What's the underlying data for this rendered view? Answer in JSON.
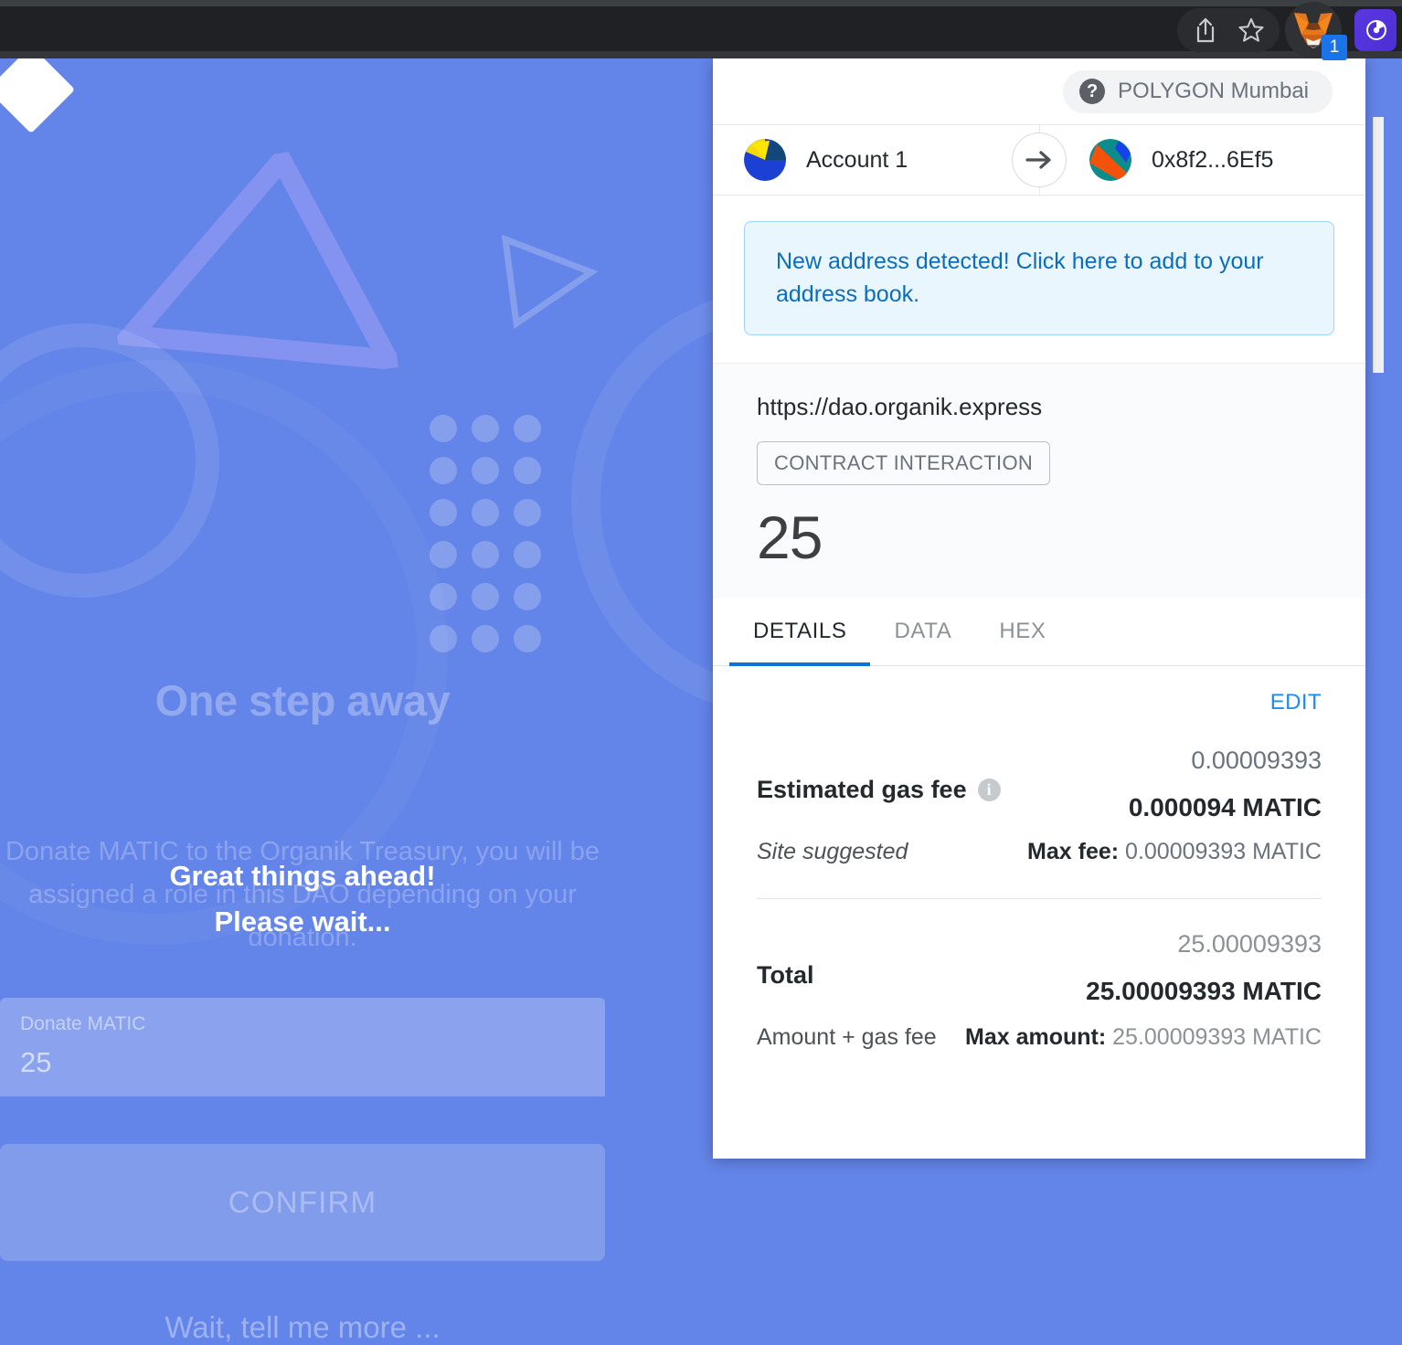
{
  "browser": {
    "icons": [
      {
        "name": "share-icon",
        "label": "Share"
      },
      {
        "name": "bookmark-star-icon",
        "label": "Bookmark"
      },
      {
        "name": "metamask-extension-icon",
        "label": "MetaMask"
      },
      {
        "name": "extension-purple-icon",
        "label": "Extension"
      }
    ],
    "metamask_badge": "1"
  },
  "dapp": {
    "hero_title": "One step away",
    "hero_subtitle": "Donate MATIC to the Organik Treasury, you will be assigned a role in this DAO depending on your donation.",
    "waiting_line1": "Great things ahead!",
    "waiting_line2": "Please wait...",
    "donate_label": "Donate MATIC",
    "donate_value": "25",
    "confirm_label": "CONFIRM",
    "more_link": "Wait, tell me more ..."
  },
  "popup": {
    "network": {
      "icon": "question-mark-icon",
      "name": "POLYGON Mumbai"
    },
    "accounts": {
      "from": "Account 1",
      "to": "0x8f2...6Ef5",
      "arrow": "arrow-right-icon"
    },
    "alert": "New address detected! Click here to add to your address book.",
    "origin": {
      "url": "https://dao.organik.express",
      "tag": "CONTRACT INTERACTION",
      "amount": "25"
    },
    "tabs": [
      {
        "label": "DETAILS",
        "active": true
      },
      {
        "label": "DATA",
        "active": false
      },
      {
        "label": "HEX",
        "active": false
      }
    ],
    "details": {
      "edit_label": "EDIT",
      "gas": {
        "title": "Estimated gas fee",
        "fiat": "0.00009393",
        "main": "0.000094 MATIC",
        "suggested": "Site suggested",
        "max_label": "Max fee:",
        "max_value": "0.00009393 MATIC"
      },
      "total": {
        "title": "Total",
        "fiat": "25.00009393",
        "main": "25.00009393 MATIC",
        "note": "Amount + gas fee",
        "max_label": "Max amount:",
        "max_value": "25.00009393 MATIC"
      }
    }
  },
  "colors": {
    "page_blue": "#6384e8",
    "accent_blue": "#0a74d8",
    "alert_blue": "#0a6ebd",
    "link_blue": "#1f8aeb"
  }
}
